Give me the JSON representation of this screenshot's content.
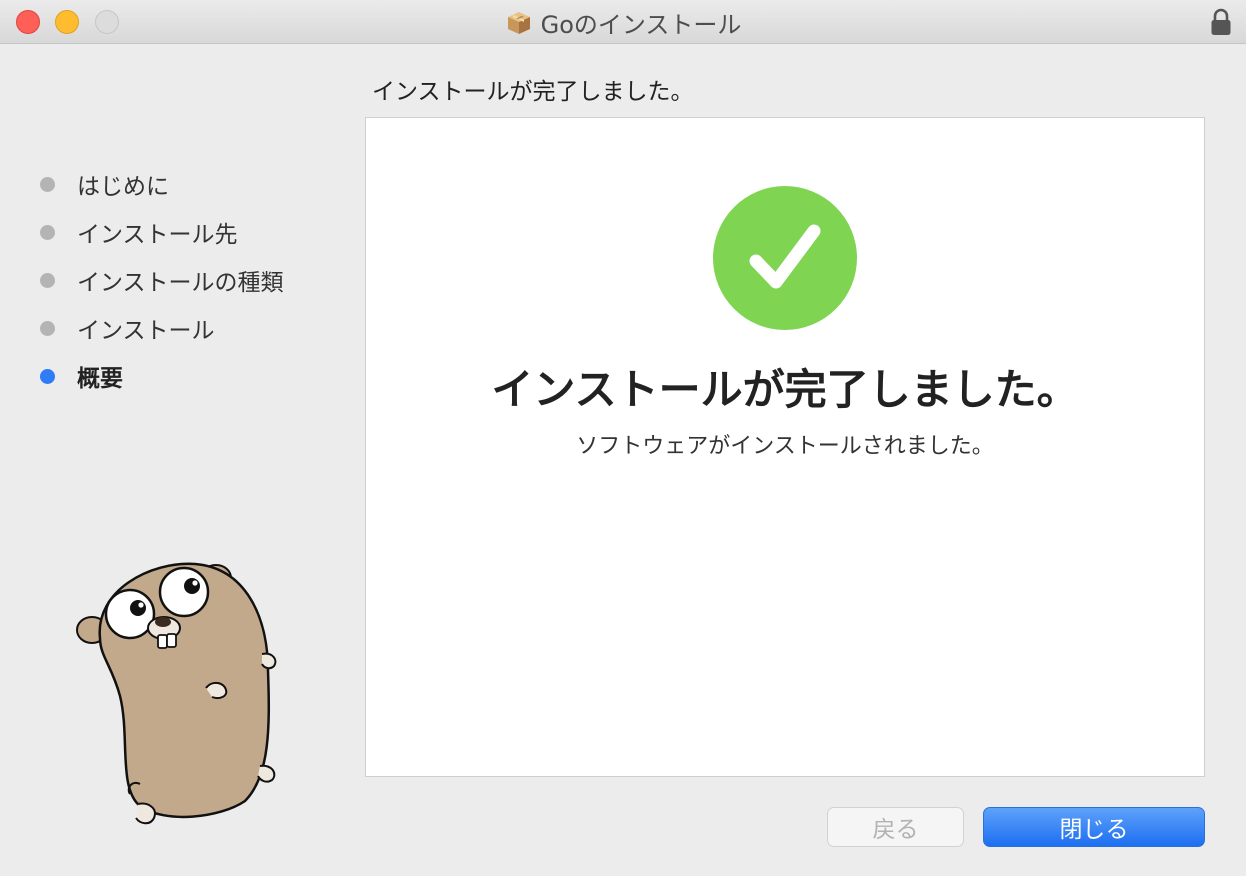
{
  "window": {
    "title": "Goのインストール",
    "icons": {
      "package": "package-icon",
      "lock": "lock-icon"
    }
  },
  "sidebar": {
    "items": [
      {
        "label": "はじめに",
        "state": "done"
      },
      {
        "label": "インストール先",
        "state": "done"
      },
      {
        "label": "インストールの種類",
        "state": "done"
      },
      {
        "label": "インストール",
        "state": "done"
      },
      {
        "label": "概要",
        "state": "current"
      }
    ]
  },
  "header": {
    "text": "インストールが完了しました。"
  },
  "content": {
    "title": "インストールが完了しました。",
    "subtitle": "ソフトウェアがインストールされました。",
    "icon": "checkmark-circle-icon"
  },
  "buttons": {
    "back": "戻る",
    "close": "閉じる"
  },
  "colors": {
    "accent": "#2e7cf6",
    "success": "#7fd452",
    "close_traffic": "#fe5f57",
    "minimize_traffic": "#febc2e"
  }
}
